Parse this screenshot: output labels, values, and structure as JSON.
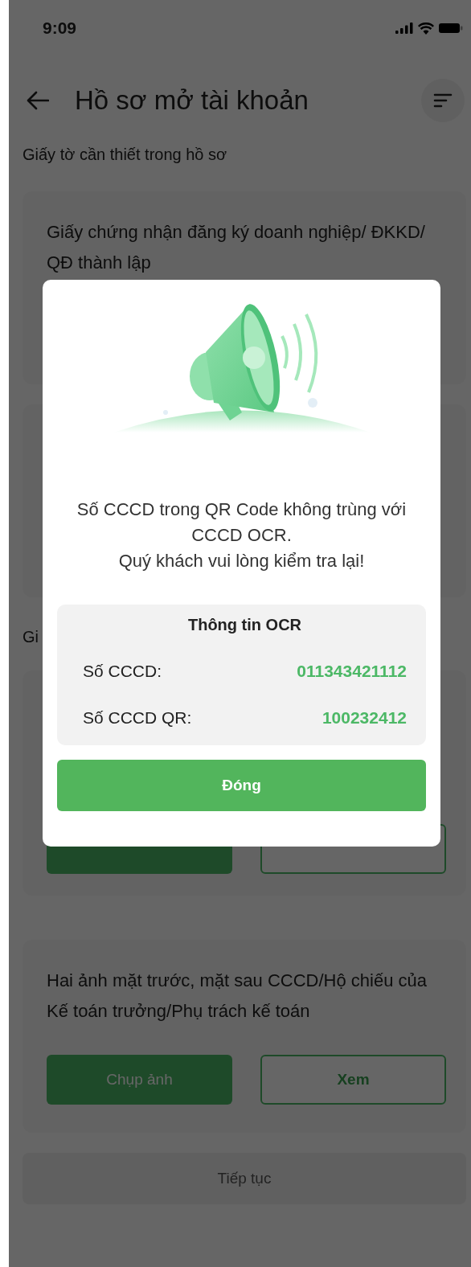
{
  "status_bar": {
    "time": "9:09"
  },
  "header": {
    "title": "Hồ sơ mở tài khoản"
  },
  "sections": [
    {
      "title": "Giấy tờ cần thiết trong hồ sơ",
      "cards": [
        {
          "description": "Giấy chứng nhận đăng ký doanh nghiệp/ ĐKKD/ QĐ thành lập"
        }
      ]
    },
    {
      "title": "Gi",
      "cards": [
        {
          "buttons": [
            {
              "kind": "primary"
            },
            {
              "kind": "outline"
            }
          ]
        },
        {
          "description": "Hai ảnh mặt trước, mặt sau CCCD/Hộ chiếu của Kế toán trưởng/Phụ trách kế toán",
          "buttons": [
            {
              "kind": "primary",
              "label": "Chụp ảnh"
            },
            {
              "kind": "outline",
              "label": "Xem"
            }
          ]
        }
      ]
    }
  ],
  "continue_button": {
    "label": "Tiếp tục",
    "disabled": true
  },
  "dialog": {
    "message": "Số CCCD trong QR Code không trùng với CCCD OCR.\nQuý khách vui lòng kiểm tra lại!",
    "info": {
      "title": "Thông tin OCR",
      "rows": [
        {
          "label": "Số CCCD:",
          "value": "011343421112"
        },
        {
          "label": "Số CCCD QR:",
          "value": "100232412"
        }
      ]
    },
    "close_button": "Đóng"
  }
}
